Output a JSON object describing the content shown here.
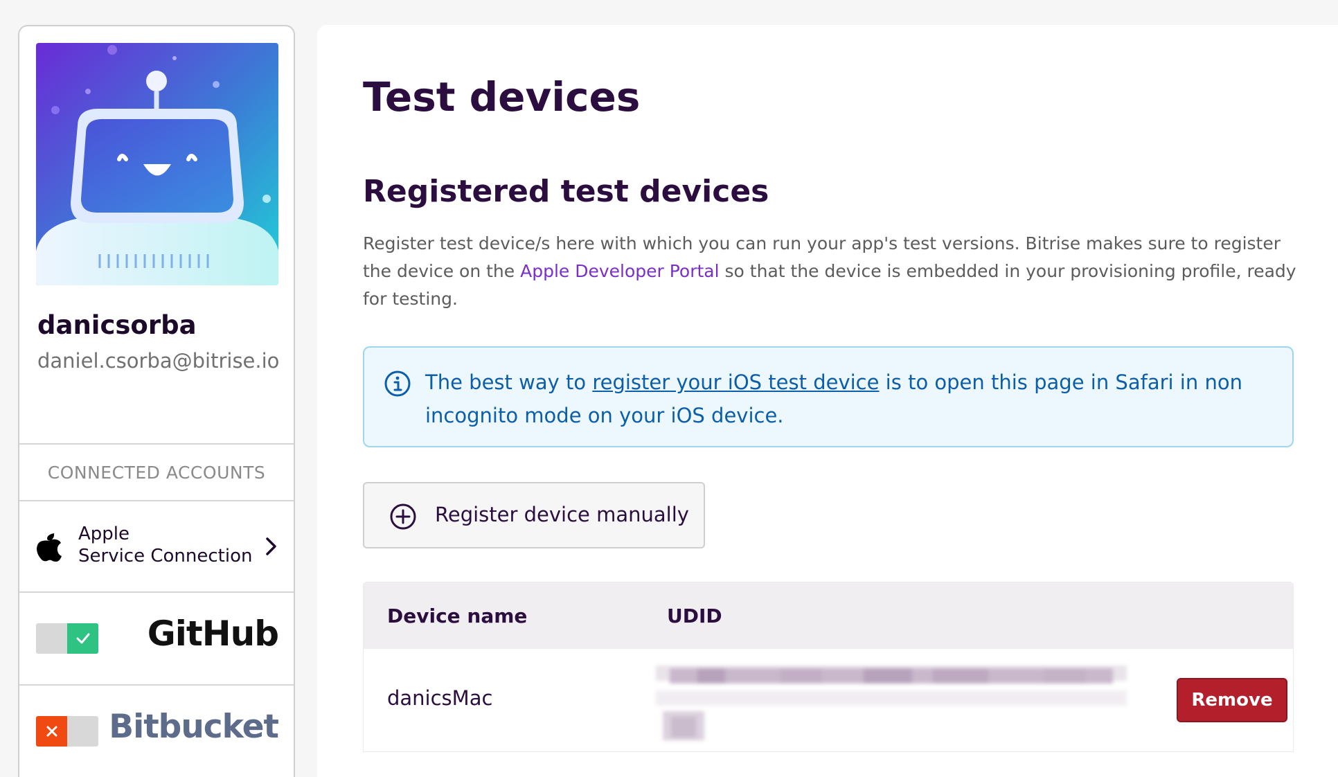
{
  "profile": {
    "username": "danicsorba",
    "email": "daniel.csorba@bitrise.io",
    "avatar_icon": "robot-avatar-icon"
  },
  "connected_accounts": {
    "title": "CONNECTED ACCOUNTS",
    "apple": {
      "line1": "Apple",
      "line2": "Service Connection",
      "icon": "apple-icon"
    },
    "github": {
      "logo": "GitHub",
      "connected": true
    },
    "bitbucket": {
      "logo": "Bitbucket",
      "connected": false
    }
  },
  "main": {
    "page_title": "Test devices",
    "section_title": "Registered test devices",
    "description": {
      "part1": "Register test device/s here with which you can run your app's test versions. Bitrise makes sure to register the device on the ",
      "link": "Apple Developer Portal",
      "part2": " so that the device is embedded in your provisioning profile, ready for testing."
    },
    "info": {
      "part1": "The best way to ",
      "link": "register your iOS test device",
      "part2": " is to open this page in Safari in non incognito mode on your iOS device."
    },
    "register_button": "Register device manually",
    "table": {
      "headers": {
        "name": "Device name",
        "udid": "UDID"
      },
      "rows": [
        {
          "name": "danicsMac",
          "remove_label": "Remove"
        }
      ]
    }
  },
  "colors": {
    "accent": "#7b2fc9",
    "title": "#2b0e3f",
    "info_text": "#0c5ea8",
    "info_bg": "#ecf8fd",
    "remove": "#b3202c",
    "github_toggle": "#2ec283",
    "bitbucket_toggle": "#f04a12"
  }
}
